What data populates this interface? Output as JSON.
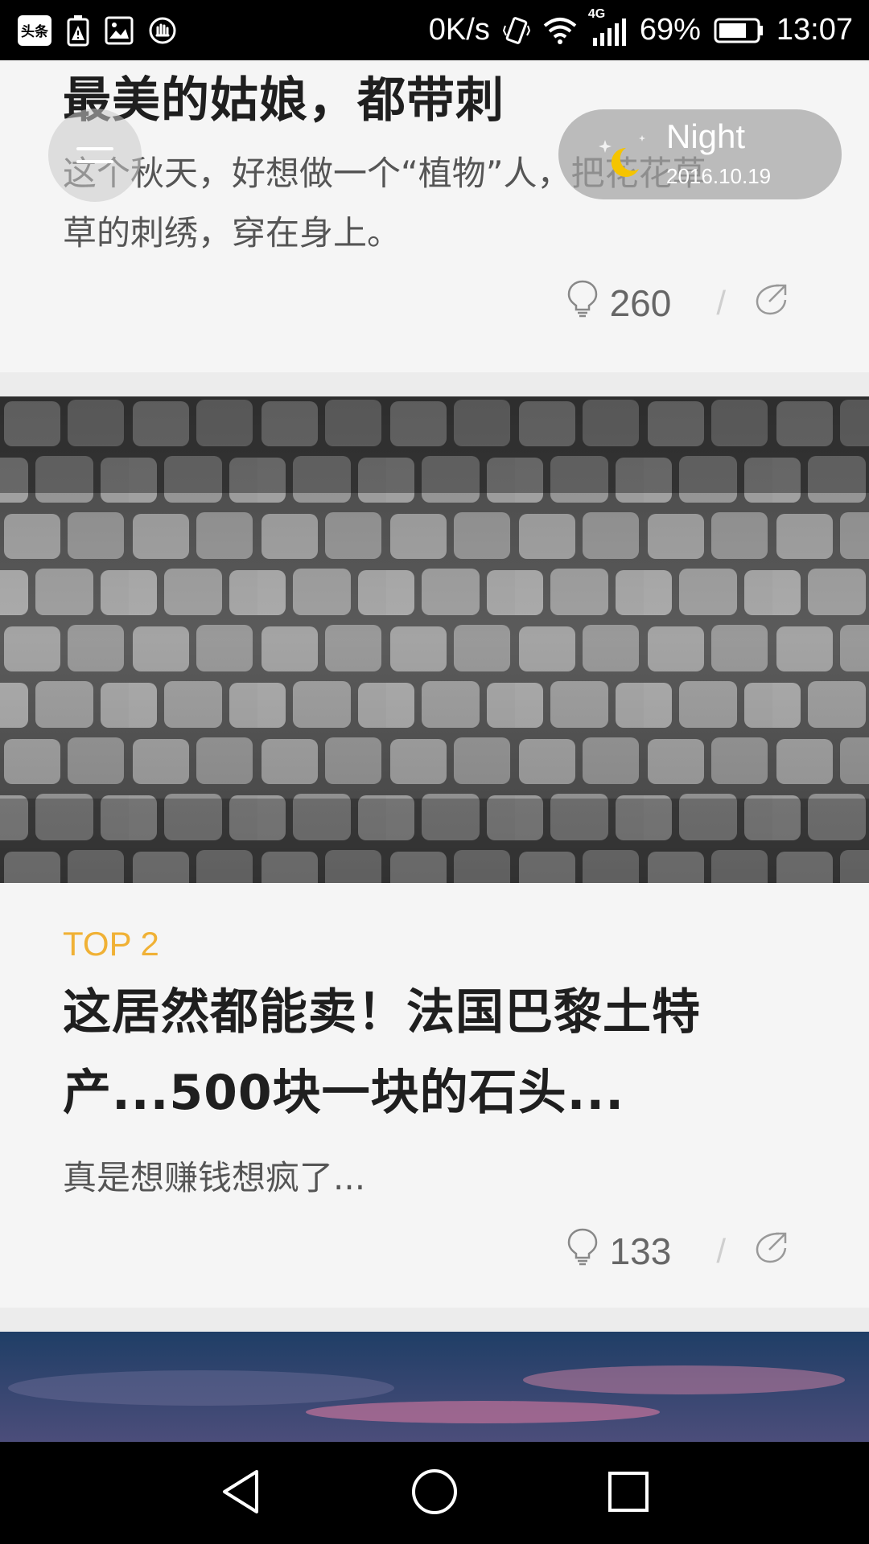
{
  "status_bar": {
    "app_badge": "头条",
    "net_speed": "0K/s",
    "network_type": "4G",
    "battery": "69%",
    "time": "13:07"
  },
  "overlay": {
    "night_label": "Night",
    "night_date": "2016.10.19"
  },
  "articles": [
    {
      "title": "最美的姑娘，都带刺",
      "desc_line1": "这个秋天，好想做一个“植物”人，把花花草",
      "desc_line2": "草的刺绣，穿在身上。",
      "comments": "260"
    },
    {
      "rank": "TOP 2",
      "title_line1": "这居然都能卖！法国巴黎土特",
      "title_line2": "产...500块一块的石头...",
      "desc": "真是想赚钱想疯了...",
      "comments": "133"
    }
  ],
  "colors": {
    "rank_accent": "#f0b135",
    "moon": "#f5c400"
  },
  "icons": [
    "comment-bulb-icon",
    "share-icon",
    "menu-icon",
    "moon-icon",
    "back-icon",
    "home-icon",
    "recents-icon"
  ]
}
